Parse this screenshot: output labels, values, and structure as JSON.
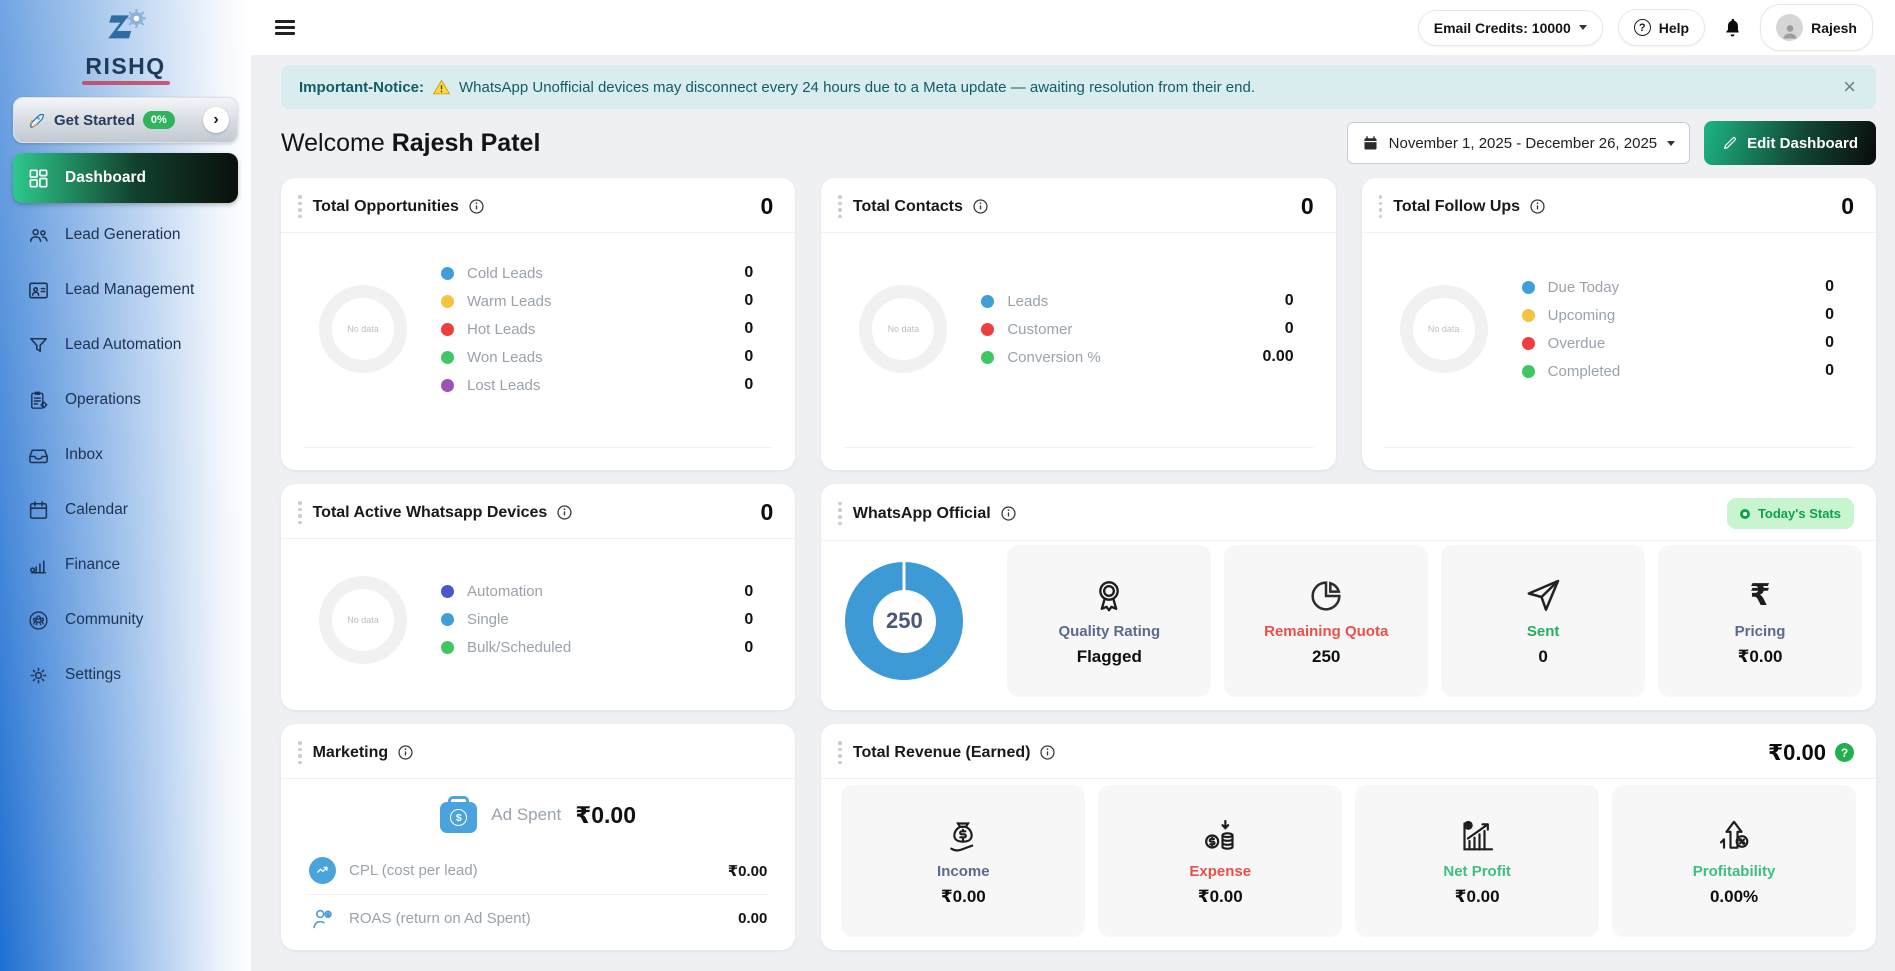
{
  "brand": {
    "name": "RISHQ"
  },
  "sidebar": {
    "get_started": {
      "label": "Get Started",
      "badge": "0%"
    },
    "items": [
      {
        "icon": "dashboard-icon",
        "label": "Dashboard"
      },
      {
        "icon": "lead-generation-icon",
        "label": "Lead Generation"
      },
      {
        "icon": "lead-management-icon",
        "label": "Lead Management"
      },
      {
        "icon": "lead-automation-icon",
        "label": "Lead Automation"
      },
      {
        "icon": "operations-icon",
        "label": "Operations"
      },
      {
        "icon": "inbox-icon",
        "label": "Inbox"
      },
      {
        "icon": "calendar-icon",
        "label": "Calendar"
      },
      {
        "icon": "finance-icon",
        "label": "Finance"
      },
      {
        "icon": "community-icon",
        "label": "Community"
      },
      {
        "icon": "settings-icon",
        "label": "Settings"
      }
    ]
  },
  "topbar": {
    "email_credits": "Email Credits: 10000",
    "help": "Help",
    "user": "Rajesh"
  },
  "notice": {
    "title": "Important-Notice:",
    "message": "WhatsApp Unofficial devices may disconnect every 24 hours due to a Meta update — awaiting resolution from their end.",
    "close": "×"
  },
  "header": {
    "welcome": "Welcome",
    "user_name": "Rajesh Patel",
    "date_range": "November 1, 2025 - December 26, 2025",
    "edit_label": "Edit Dashboard"
  },
  "common": {
    "no_data": "No data"
  },
  "cards": {
    "opportunities": {
      "title": "Total Opportunities",
      "total": "0",
      "legend": [
        {
          "label": "Cold Leads",
          "value": "0",
          "color": "#3f9fdb"
        },
        {
          "label": "Warm Leads",
          "value": "0",
          "color": "#f5c242"
        },
        {
          "label": "Hot Leads",
          "value": "0",
          "color": "#f03e3e"
        },
        {
          "label": "Won Leads",
          "value": "0",
          "color": "#3ec763"
        },
        {
          "label": "Lost Leads",
          "value": "0",
          "color": "#9b51b6"
        }
      ]
    },
    "contacts": {
      "title": "Total Contacts",
      "total": "0",
      "legend": [
        {
          "label": "Leads",
          "value": "0",
          "color": "#3f9fdb"
        },
        {
          "label": "Customer",
          "value": "0",
          "color": "#f03e3e"
        },
        {
          "label": "Conversion %",
          "value": "0.00",
          "color": "#3ec763"
        }
      ]
    },
    "followups": {
      "title": "Total Follow Ups",
      "total": "0",
      "legend": [
        {
          "label": "Due Today",
          "value": "0",
          "color": "#3f9fdb"
        },
        {
          "label": "Upcoming",
          "value": "0",
          "color": "#f5c242"
        },
        {
          "label": "Overdue",
          "value": "0",
          "color": "#f03e3e"
        },
        {
          "label": "Completed",
          "value": "0",
          "color": "#3ec763"
        }
      ]
    },
    "devices": {
      "title": "Total Active Whatsapp Devices",
      "total": "0",
      "legend": [
        {
          "label": "Automation",
          "value": "0",
          "color": "#4a57c9"
        },
        {
          "label": "Single",
          "value": "0",
          "color": "#3f9fdb"
        },
        {
          "label": "Bulk/Scheduled",
          "value": "0",
          "color": "#3ec763"
        }
      ]
    },
    "whatsapp": {
      "title": "WhatsApp Official",
      "badge": "Today's Stats",
      "donut_value": "250",
      "donut_color": "#3d9ad6",
      "tiles": [
        {
          "icon": "medal-icon",
          "label": "Quality Rating",
          "value": "Flagged",
          "color": "#5a6b8c"
        },
        {
          "icon": "pie-icon",
          "label": "Remaining Quota",
          "value": "250",
          "color": "#e8504a"
        },
        {
          "icon": "send-icon",
          "label": "Sent",
          "value": "0",
          "color": "#27ae60"
        },
        {
          "icon": "rupee-icon",
          "label": "Pricing",
          "value": "₹0.00",
          "color": "#5a6b8c"
        }
      ]
    },
    "marketing": {
      "title": "Marketing",
      "ad_spent": {
        "label": "Ad Spent",
        "value": "₹0.00"
      },
      "rows": [
        {
          "icon": "trend-up-icon",
          "label": "CPL (cost per lead)",
          "value": "₹0.00"
        },
        {
          "icon": "person-coin-icon",
          "label": "ROAS (return on Ad Spent)",
          "value": "0.00"
        }
      ]
    },
    "revenue": {
      "title": "Total Revenue (Earned)",
      "total": "₹0.00",
      "help": "?",
      "tiles": [
        {
          "icon": "income-icon",
          "label": "Income",
          "value": "₹0.00",
          "color": "#5a6b8c"
        },
        {
          "icon": "expense-icon",
          "label": "Expense",
          "value": "₹0.00",
          "color": "#e8504a"
        },
        {
          "icon": "net-profit-icon",
          "label": "Net Profit",
          "value": "₹0.00",
          "color": "#3fbf7f"
        },
        {
          "icon": "profitability-icon",
          "label": "Profitability",
          "value": "0.00%",
          "color": "#3fbf7f"
        }
      ]
    }
  }
}
